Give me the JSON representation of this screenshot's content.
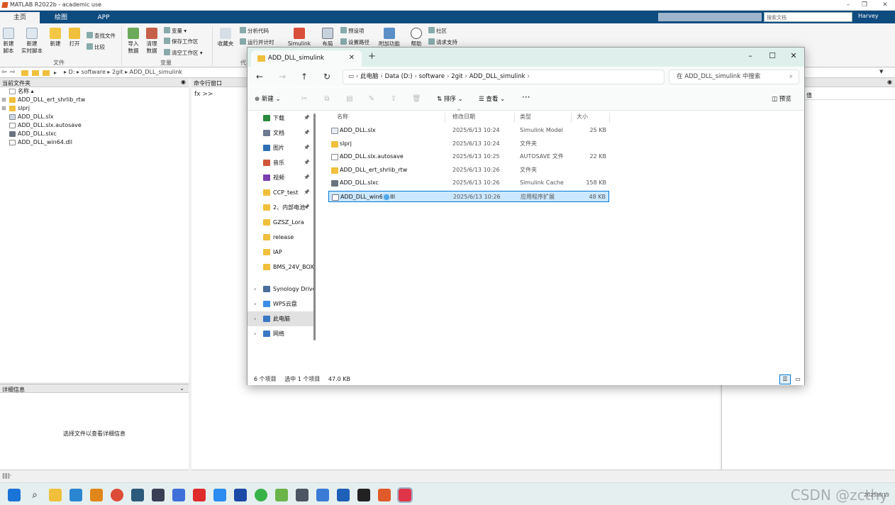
{
  "matlab": {
    "title": "MATLAB R2022b - academic use",
    "tabs": [
      "主页",
      "绘图",
      "APP"
    ],
    "search_placeholder": "搜索文档",
    "user": "Harvey",
    "ribbon": {
      "new_script": "新建\n脚本",
      "new_live_script": "新建\n实时脚本",
      "new": "新建",
      "open": "打开",
      "find_files": "查找文件",
      "compare": "比较",
      "import_data": "导入\n数据",
      "clean_data": "清理\n数据",
      "variable": "变量",
      "save_workspace": "保存工作区",
      "clear_workspace": "清空工作区",
      "favorites": "收藏夹",
      "analyze_code": "分析代码",
      "run_and_time": "运行并计时",
      "simulink": "Simulink",
      "layout": "布局",
      "preferences": "预设项",
      "set_path": "设置路径",
      "addons": "附加功能",
      "help": "帮助",
      "community": "社区",
      "request_support": "请求支持",
      "group_file": "文件",
      "group_variable": "变量",
      "group_code": "代"
    },
    "address": {
      "drive": "D:",
      "parts": [
        "software",
        "2git",
        "ADD_DLL_simulink"
      ]
    },
    "current_folder_label": "当前文件夹",
    "name_col": "名称",
    "files": [
      {
        "name": "ADD_DLL_ert_shrlib_rtw",
        "type": "folder",
        "expandable": true
      },
      {
        "name": "slprj",
        "type": "folder",
        "expandable": true
      },
      {
        "name": "ADD_DLL.slx",
        "type": "slx",
        "expandable": false
      },
      {
        "name": "ADD_DLL.slx.autosave",
        "type": "file",
        "expandable": false
      },
      {
        "name": "ADD_DLL.slxc",
        "type": "slxc",
        "expandable": false
      },
      {
        "name": "ADD_DLL_win64.dll",
        "type": "file",
        "expandable": false
      }
    ],
    "details_label": "详细信息",
    "details_placeholder": "选择文件以查看详细信息",
    "command_window_label": "命令行窗口",
    "prompt": "fx >>",
    "workspace_value_col": "值"
  },
  "explorer": {
    "tab_title": "ADD_DLL_simulink",
    "breadcrumb": [
      "此电脑",
      "Data (D:)",
      "software",
      "2git",
      "ADD_DLL_simulink"
    ],
    "search_placeholder": "在 ADD_DLL_simulink 中搜索",
    "cmd": {
      "new": "新建",
      "sort": "排序",
      "view": "查看",
      "more": "···",
      "preview": "预览"
    },
    "nav": [
      {
        "label": "下载",
        "icon": "download",
        "pinned": true,
        "color": "#2a8a3e"
      },
      {
        "label": "文档",
        "icon": "document",
        "pinned": true,
        "color": "#6b7a8f"
      },
      {
        "label": "图片",
        "icon": "picture",
        "pinned": true,
        "color": "#2f6fb5"
      },
      {
        "label": "音乐",
        "icon": "music",
        "pinned": true,
        "color": "#d2553b"
      },
      {
        "label": "视频",
        "icon": "video",
        "pinned": true,
        "color": "#7b3fb0"
      },
      {
        "label": "CCP_test",
        "icon": "folder",
        "pinned": true,
        "color": "#f0bf3c"
      },
      {
        "label": "2、内部电池",
        "icon": "folder",
        "pinned": true,
        "color": "#f0bf3c"
      },
      {
        "label": "GZSZ_Lora",
        "icon": "folder",
        "pinned": false,
        "color": "#f0bf3c"
      },
      {
        "label": "release",
        "icon": "folder",
        "pinned": false,
        "color": "#f0bf3c"
      },
      {
        "label": "IAP",
        "icon": "folder",
        "pinned": false,
        "color": "#f0bf3c"
      },
      {
        "label": "BMS_24V_BOX",
        "icon": "folder",
        "pinned": false,
        "color": "#f0bf3c"
      }
    ],
    "nav_roots": [
      {
        "label": "Synology Drive",
        "icon": "synology",
        "color": "#4b6e9c",
        "selected": false
      },
      {
        "label": "WPS云盘",
        "icon": "cloud",
        "color": "#3a8ee6",
        "selected": false
      },
      {
        "label": "此电脑",
        "icon": "computer",
        "color": "#3b78c4",
        "selected": true
      },
      {
        "label": "网络",
        "icon": "network",
        "color": "#3b78c4",
        "selected": false
      }
    ],
    "columns": [
      "名称",
      "修改日期",
      "类型",
      "大小"
    ],
    "rows": [
      {
        "name": "ADD_DLL.slx",
        "date": "2025/6/13 10:24",
        "type": "Simulink Model",
        "size": "25 KB",
        "icon": "slx",
        "selected": false
      },
      {
        "name": "slprj",
        "date": "2025/6/13 10:24",
        "type": "文件夹",
        "size": "",
        "icon": "folder",
        "selected": false
      },
      {
        "name": "ADD_DLL.slx.autosave",
        "date": "2025/6/13 10:25",
        "type": "AUTOSAVE 文件",
        "size": "22 KB",
        "icon": "file",
        "selected": false
      },
      {
        "name": "ADD_DLL_ert_shrlib_rtw",
        "date": "2025/6/13 10:26",
        "type": "文件夹",
        "size": "",
        "icon": "folder",
        "selected": false
      },
      {
        "name": "ADD_DLL.slxc",
        "date": "2025/6/13 10:26",
        "type": "Simulink Cache",
        "size": "158 KB",
        "icon": "slxc",
        "selected": false
      },
      {
        "name": "ADD_DLL_win64.dll",
        "date": "2025/6/13 10:26",
        "type": "应用程序扩展",
        "size": "48 KB",
        "icon": "dll",
        "selected": true
      }
    ],
    "status": {
      "count": "6 个项目",
      "selected": "选中 1 个项目",
      "size": "47.0 KB"
    }
  },
  "taskbar": {
    "watermark": "CSDN @zcthy",
    "clock": "2025/6/13"
  },
  "colors": {
    "matlab_blue": "#0e4b7f",
    "explorer_title": "#dff0ec",
    "selection": "#cce8ff",
    "selection_border": "#0078d4",
    "folder": "#f0bf3c"
  }
}
